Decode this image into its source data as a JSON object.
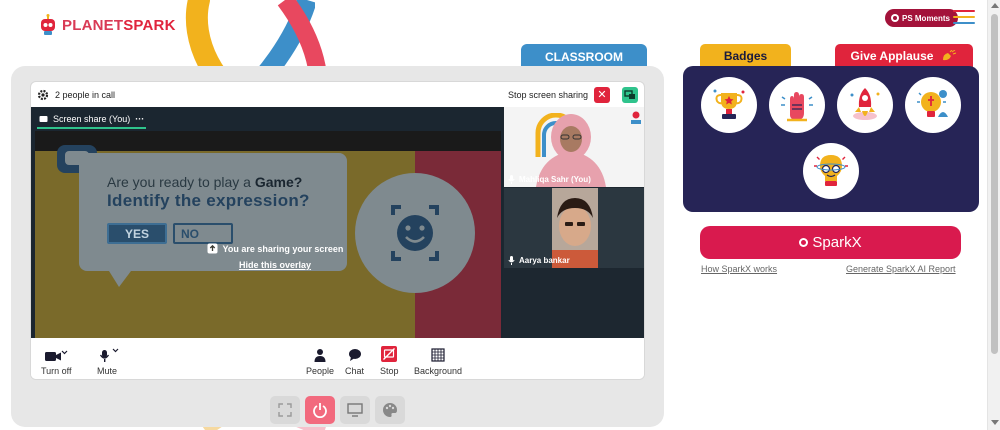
{
  "header": {
    "logo_part1": "PLANET",
    "logo_part2": "SPARK",
    "ps_moments_label": "PS Moments"
  },
  "classroom": {
    "tab_label": "CLASSROOM",
    "people_in_call": "2 people in call",
    "stop_screen_sharing": "Stop screen sharing",
    "share_tab_label": "Screen share (You)",
    "shared_content": {
      "question_prefix": "Are you ready to play a ",
      "question_bold": "Game?",
      "prompt": "Identify the expression?",
      "yes_label": "YES",
      "no_label": "NO"
    },
    "overlay": {
      "sharing_text": "You are sharing your screen",
      "hide_link": "Hide this overlay"
    },
    "participants": [
      {
        "name": "Mahliqa Sahr (You)"
      },
      {
        "name": "Aarya bankar"
      }
    ],
    "toolbar": {
      "turn_off": "Turn off",
      "mute": "Mute",
      "people": "People",
      "chat": "Chat",
      "stop": "Stop",
      "background": "Background"
    }
  },
  "right_panel": {
    "badges_tab": "Badges",
    "applause_tab": "Give Applause",
    "sparkx_label": "SparkX",
    "how_sparkx_works": "How SparkX works",
    "generate_report": "Generate SparkX AI Report"
  },
  "colors": {
    "brand_red": "#e0243c",
    "classroom_blue": "#3d8fc9",
    "badges_yellow": "#f2b21d",
    "badges_panel": "#262456",
    "sparkx_button": "#d91a4e",
    "accent_green": "#2fc38c"
  }
}
